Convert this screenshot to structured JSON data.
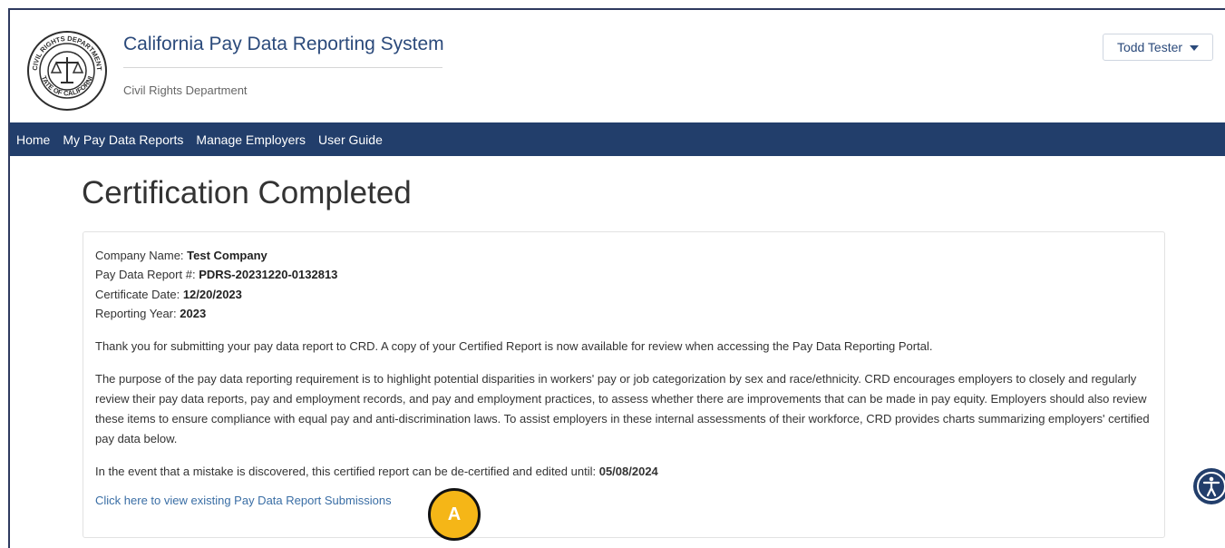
{
  "header": {
    "app_title": "California Pay Data Reporting System",
    "department": "Civil Rights Department",
    "user_name": "Todd Tester",
    "seal_text_top": "CIVIL RIGHTS DEPARTMENT",
    "seal_text_bottom": "STATE OF CALIFORNIA"
  },
  "nav": {
    "items": [
      {
        "label": "Home"
      },
      {
        "label": "My Pay Data Reports"
      },
      {
        "label": "Manage Employers"
      },
      {
        "label": "User Guide"
      }
    ]
  },
  "page": {
    "title": "Certification Completed"
  },
  "details": {
    "company_label": "Company Name:",
    "company_value": "Test Company",
    "report_label": "Pay Data Report #:",
    "report_value": "PDRS-20231220-0132813",
    "cert_date_label": "Certificate Date:",
    "cert_date_value": "12/20/2023",
    "year_label": "Reporting Year:",
    "year_value": "2023"
  },
  "body": {
    "thank_you": "Thank you for submitting your pay data report to CRD. A copy of your Certified Report is now available for review when accessing the Pay Data Reporting Portal.",
    "purpose": "The purpose of the pay data reporting requirement is to highlight potential disparities in workers' pay or job categorization by sex and race/ethnicity. CRD encourages employers to closely and regularly review their pay data reports, pay and employment records, and pay and employment practices, to assess whether there are improvements that can be made in pay equity. Employers should also review these items to ensure compliance with equal pay and anti-discrimination laws. To assist employers in these internal assessments of their workforce, CRD provides charts summarizing employers' certified pay data below.",
    "mistake_text": "In the event that a mistake is discovered, this certified report can be de-certified and edited until:",
    "mistake_date": "05/08/2024",
    "view_link": "Click here to view existing Pay Data Report Submissions"
  },
  "annotation": {
    "marker_label": "A",
    "marker_color": "#f5b617"
  },
  "colors": {
    "nav_bg": "#223e6b",
    "title_blue": "#2b4a7b",
    "link_blue": "#3a6ea5"
  }
}
